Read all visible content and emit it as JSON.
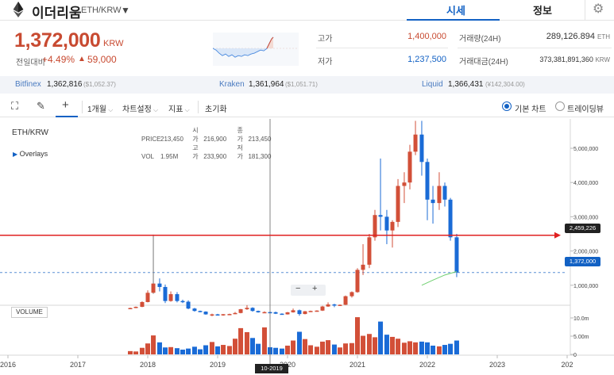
{
  "header": {
    "coin_name": "이더리움",
    "pair": "ETH/KRW",
    "tabs": [
      {
        "label": "시세",
        "active": true
      },
      {
        "label": "정보",
        "active": false
      }
    ],
    "icons": {
      "logo": "ethereum-logo",
      "dropdown": "chevron-down-icon",
      "settings": "gear-icon"
    }
  },
  "price": {
    "current": "1,372,000",
    "unit": "KRW",
    "change_label": "전일대비",
    "change_percent": "+4.49%",
    "change_amount": "59,000",
    "change_arrow": "▲"
  },
  "stats": {
    "high_label": "고가",
    "high": "1,400,000",
    "low_label": "저가",
    "low": "1,237,500",
    "volume_label": "거래량(24H)",
    "volume": "289,126.894",
    "volume_unit": "ETH",
    "amount_label": "거래대금(24H)",
    "amount": "373,381,891,360",
    "amount_unit": "KRW"
  },
  "exchanges": [
    {
      "name": "Bitfinex",
      "price": "1,362,816",
      "usd": "($1,052.37)"
    },
    {
      "name": "Kraken",
      "price": "1,361,964",
      "usd": "($1,051.71)"
    },
    {
      "name": "Liquid",
      "price": "1,366,431",
      "usd": "(¥142,304.00)"
    }
  ],
  "toolbar": {
    "interval": "1개월",
    "chart_settings": "차트설정",
    "indicators": "지표",
    "reset": "초기화",
    "basic_chart": "기본 차트",
    "tradingview": "트레이딩뷰",
    "basic_selected": true,
    "icons": [
      "fullscreen-icon",
      "pencil-icon",
      "crosshair-icon"
    ]
  },
  "chart_info": {
    "symbol": "ETH/KRW",
    "overlays": "Overlays",
    "price_label": "PRICE",
    "price_val": "213,450",
    "vol_label": "VOL",
    "vol_val": "1.95M",
    "open_label": "시가",
    "open_val": "216,900",
    "high_label": "고가",
    "high_val": "233,900",
    "close_label": "종가",
    "close_val": "213,450",
    "low_label": "저가",
    "low_val": "181,300",
    "volume_label": "VOLUME",
    "zoom_out": "−",
    "zoom_in": "+",
    "hover_date": "10-2019",
    "line_price_tag": "2,459,226",
    "current_price_tag": "1,372,000"
  },
  "chart_data": {
    "type": "candlestick",
    "x_axis_labels": [
      "2016",
      "2017",
      "2018",
      "2019",
      "2020",
      "2021",
      "2022",
      "2023",
      "202"
    ],
    "price_axis_labels": [
      "5,000,000",
      "4,000,000",
      "3,000,000",
      "2,000,000",
      "1,000,000"
    ],
    "volume_axis_labels": [
      "10.0m",
      "5.00m",
      "0"
    ],
    "colors": {
      "up": "#d24f38",
      "down": "#1a6bd6",
      "hline": "#e02020",
      "dashed": "#5a8fd6",
      "ma": "#6fcf6f"
    },
    "candles": [
      {
        "t": 2017.75,
        "o": 330000,
        "h": 345000,
        "l": 320000,
        "c": 335000,
        "v": 0.9
      },
      {
        "t": 2017.83,
        "o": 335000,
        "h": 380000,
        "l": 330000,
        "c": 370000,
        "v": 0.8
      },
      {
        "t": 2017.92,
        "o": 370000,
        "h": 530000,
        "l": 360000,
        "c": 510000,
        "v": 1.8
      },
      {
        "t": 2018.0,
        "o": 510000,
        "h": 850000,
        "l": 500000,
        "c": 780000,
        "v": 3.0
      },
      {
        "t": 2018.08,
        "o": 780000,
        "h": 2480000,
        "l": 750000,
        "c": 1050000,
        "v": 5.2
      },
      {
        "t": 2018.17,
        "o": 1050000,
        "h": 1200000,
        "l": 820000,
        "c": 950000,
        "v": 3.3
      },
      {
        "t": 2018.25,
        "o": 950000,
        "h": 1020000,
        "l": 480000,
        "c": 540000,
        "v": 1.9
      },
      {
        "t": 2018.33,
        "o": 540000,
        "h": 820000,
        "l": 520000,
        "c": 740000,
        "v": 2.0
      },
      {
        "t": 2018.42,
        "o": 740000,
        "h": 800000,
        "l": 500000,
        "c": 540000,
        "v": 1.7
      },
      {
        "t": 2018.5,
        "o": 540000,
        "h": 580000,
        "l": 480000,
        "c": 520000,
        "v": 1.3
      },
      {
        "t": 2018.58,
        "o": 520000,
        "h": 560000,
        "l": 300000,
        "c": 320000,
        "v": 1.6
      },
      {
        "t": 2018.67,
        "o": 320000,
        "h": 340000,
        "l": 230000,
        "c": 250000,
        "v": 2.1
      },
      {
        "t": 2018.75,
        "o": 250000,
        "h": 260000,
        "l": 210000,
        "c": 230000,
        "v": 1.4
      },
      {
        "t": 2018.83,
        "o": 230000,
        "h": 240000,
        "l": 140000,
        "c": 150000,
        "v": 2.5
      },
      {
        "t": 2018.92,
        "o": 150000,
        "h": 170000,
        "l": 95000,
        "c": 150000,
        "v": 3.4
      },
      {
        "t": 2019.0,
        "o": 150000,
        "h": 165000,
        "l": 115000,
        "c": 120000,
        "v": 2.2
      },
      {
        "t": 2019.08,
        "o": 120000,
        "h": 160000,
        "l": 110000,
        "c": 155000,
        "v": 2.6
      },
      {
        "t": 2019.17,
        "o": 155000,
        "h": 170000,
        "l": 145000,
        "c": 160000,
        "v": 2.3
      },
      {
        "t": 2019.25,
        "o": 160000,
        "h": 220000,
        "l": 155000,
        "c": 190000,
        "v": 4.3
      },
      {
        "t": 2019.33,
        "o": 190000,
        "h": 310000,
        "l": 180000,
        "c": 300000,
        "v": 7.2
      },
      {
        "t": 2019.42,
        "o": 300000,
        "h": 420000,
        "l": 280000,
        "c": 340000,
        "v": 6.1
      },
      {
        "t": 2019.5,
        "o": 340000,
        "h": 360000,
        "l": 230000,
        "c": 250000,
        "v": 4.5
      },
      {
        "t": 2019.58,
        "o": 250000,
        "h": 260000,
        "l": 200000,
        "c": 210000,
        "v": 2.9
      },
      {
        "t": 2019.67,
        "o": 210000,
        "h": 240000,
        "l": 190000,
        "c": 216000,
        "v": 7.4
      },
      {
        "t": 2019.75,
        "o": 216900,
        "h": 233900,
        "l": 181300,
        "c": 213450,
        "v": 1.95
      },
      {
        "t": 2019.83,
        "o": 213000,
        "h": 230000,
        "l": 160000,
        "c": 170000,
        "v": 1.8
      },
      {
        "t": 2019.92,
        "o": 170000,
        "h": 180000,
        "l": 140000,
        "c": 150000,
        "v": 1.6
      },
      {
        "t": 2020.0,
        "o": 150000,
        "h": 220000,
        "l": 145000,
        "c": 210000,
        "v": 2.4
      },
      {
        "t": 2020.08,
        "o": 210000,
        "h": 320000,
        "l": 200000,
        "c": 270000,
        "v": 3.8
      },
      {
        "t": 2020.17,
        "o": 270000,
        "h": 290000,
        "l": 110000,
        "c": 160000,
        "v": 6.2
      },
      {
        "t": 2020.25,
        "o": 160000,
        "h": 250000,
        "l": 150000,
        "c": 240000,
        "v": 4.2
      },
      {
        "t": 2020.33,
        "o": 240000,
        "h": 260000,
        "l": 220000,
        "c": 250000,
        "v": 2.5
      },
      {
        "t": 2020.42,
        "o": 250000,
        "h": 270000,
        "l": 230000,
        "c": 260000,
        "v": 2.1
      },
      {
        "t": 2020.5,
        "o": 260000,
        "h": 400000,
        "l": 250000,
        "c": 380000,
        "v": 3.5
      },
      {
        "t": 2020.58,
        "o": 380000,
        "h": 500000,
        "l": 370000,
        "c": 440000,
        "v": 3.9
      },
      {
        "t": 2020.67,
        "o": 440000,
        "h": 460000,
        "l": 360000,
        "c": 420000,
        "v": 2.7
      },
      {
        "t": 2020.75,
        "o": 420000,
        "h": 440000,
        "l": 400000,
        "c": 430000,
        "v": 1.9
      },
      {
        "t": 2020.83,
        "o": 430000,
        "h": 700000,
        "l": 420000,
        "c": 680000,
        "v": 3.0
      },
      {
        "t": 2020.92,
        "o": 680000,
        "h": 820000,
        "l": 640000,
        "c": 800000,
        "v": 3.1
      },
      {
        "t": 2021.0,
        "o": 800000,
        "h": 1500000,
        "l": 780000,
        "c": 1450000,
        "v": 10.2
      },
      {
        "t": 2021.08,
        "o": 1450000,
        "h": 2200000,
        "l": 1300000,
        "c": 1600000,
        "v": 5.1
      },
      {
        "t": 2021.17,
        "o": 1600000,
        "h": 2500000,
        "l": 1500000,
        "c": 2400000,
        "v": 5.6
      },
      {
        "t": 2021.25,
        "o": 2400000,
        "h": 3200000,
        "l": 2300000,
        "c": 3050000,
        "v": 4.7
      },
      {
        "t": 2021.33,
        "o": 3050000,
        "h": 4700000,
        "l": 2600000,
        "c": 3000000,
        "v": 9.0
      },
      {
        "t": 2021.42,
        "o": 3000000,
        "h": 3200000,
        "l": 2200000,
        "c": 2600000,
        "v": 5.4
      },
      {
        "t": 2021.5,
        "o": 2600000,
        "h": 2900000,
        "l": 2100000,
        "c": 2850000,
        "v": 4.8
      },
      {
        "t": 2021.58,
        "o": 2850000,
        "h": 4100000,
        "l": 2700000,
        "c": 3900000,
        "v": 4.3
      },
      {
        "t": 2021.67,
        "o": 3900000,
        "h": 4300000,
        "l": 3400000,
        "c": 4000000,
        "v": 3.2
      },
      {
        "t": 2021.75,
        "o": 4000000,
        "h": 5100000,
        "l": 3800000,
        "c": 4900000,
        "v": 3.6
      },
      {
        "t": 2021.83,
        "o": 4900000,
        "h": 5800000,
        "l": 4800000,
        "c": 5400000,
        "v": 3.3
      },
      {
        "t": 2021.92,
        "o": 5400000,
        "h": 5800000,
        "l": 4200000,
        "c": 4600000,
        "v": 3.5
      },
      {
        "t": 2022.0,
        "o": 4600000,
        "h": 4700000,
        "l": 2900000,
        "c": 3500000,
        "v": 3.3
      },
      {
        "t": 2022.08,
        "o": 3500000,
        "h": 3900000,
        "l": 2800000,
        "c": 3400000,
        "v": 2.4
      },
      {
        "t": 2022.17,
        "o": 3400000,
        "h": 4300000,
        "l": 3200000,
        "c": 3900000,
        "v": 2.2
      },
      {
        "t": 2022.25,
        "o": 3900000,
        "h": 4000000,
        "l": 3300000,
        "c": 3500000,
        "v": 2.6
      },
      {
        "t": 2022.33,
        "o": 3500000,
        "h": 3550000,
        "l": 2300000,
        "c": 2400000,
        "v": 2.9
      },
      {
        "t": 2022.42,
        "o": 2400000,
        "h": 2500000,
        "l": 1237500,
        "c": 1372000,
        "v": 3.8
      }
    ],
    "ma_line": [
      [
        2021.92,
        1000000
      ],
      [
        2022.08,
        1150000
      ],
      [
        2022.25,
        1300000
      ],
      [
        2022.42,
        1400000
      ]
    ],
    "horizontal_line": 2459226,
    "current_price_line": 1372000
  }
}
